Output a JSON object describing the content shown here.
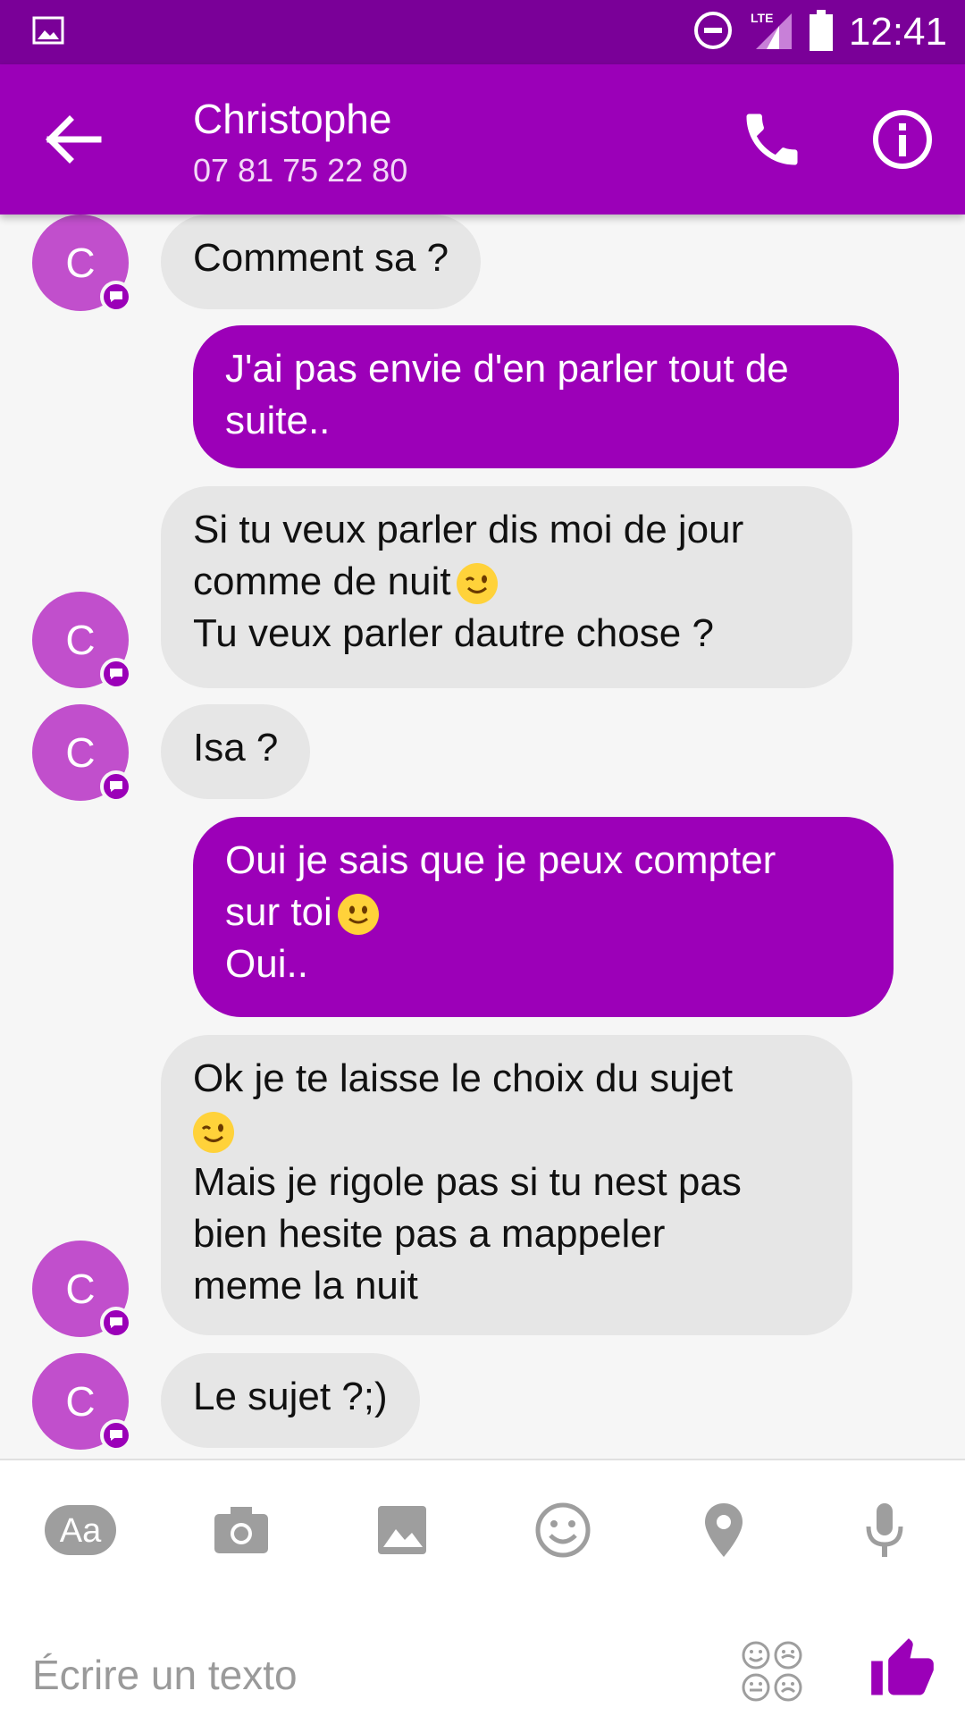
{
  "status_bar": {
    "time": "12:41",
    "network": "LTE",
    "icons": [
      "gallery-notification-icon",
      "do-not-disturb-icon",
      "lte-signal-icon",
      "battery-icon"
    ]
  },
  "header": {
    "contact_name": "Christophe",
    "contact_phone": "07 81 75 22 80",
    "icons": [
      "back-arrow-icon",
      "phone-icon",
      "info-icon"
    ]
  },
  "messages": [
    {
      "direction": "incoming",
      "avatar_letter": "C",
      "lines": [
        "Comment sa ?"
      ]
    },
    {
      "direction": "outgoing",
      "lines": [
        "J'ai pas envie d'en parler tout de",
        "suite.."
      ]
    },
    {
      "direction": "incoming",
      "avatar_letter": "C",
      "lines": [
        "Si tu veux parler dis moi de jour",
        "comme de nuit",
        "Tu veux parler dautre chose ?"
      ]
    },
    {
      "direction": "incoming",
      "avatar_letter": "C",
      "lines": [
        "Isa ?"
      ]
    },
    {
      "direction": "outgoing",
      "lines": [
        "Oui je sais que je peux compter",
        "sur toi",
        "Oui.."
      ]
    },
    {
      "direction": "incoming",
      "avatar_letter": "C",
      "lines": [
        "Ok je te laisse le choix du sujet",
        "",
        "Mais je rigole pas si tu nest pas",
        "bien hesite pas a mappeler",
        "meme la nuit"
      ]
    },
    {
      "direction": "incoming",
      "avatar_letter": "C",
      "lines": [
        "Le sujet ?;)"
      ]
    }
  ],
  "composer": {
    "placeholder": "Écrire un texto",
    "aa_label": "Aa",
    "tools": [
      "text-format-icon",
      "camera-icon",
      "image-icon",
      "emoji-icon",
      "location-pin-icon",
      "microphone-icon"
    ]
  },
  "colors": {
    "status_bar": "#7a0098",
    "app_bar": "#9b00b8",
    "outgoing_bubble": "#9c00b8",
    "incoming_bubble": "#e6e6e6",
    "avatar": "#c14fcc"
  }
}
